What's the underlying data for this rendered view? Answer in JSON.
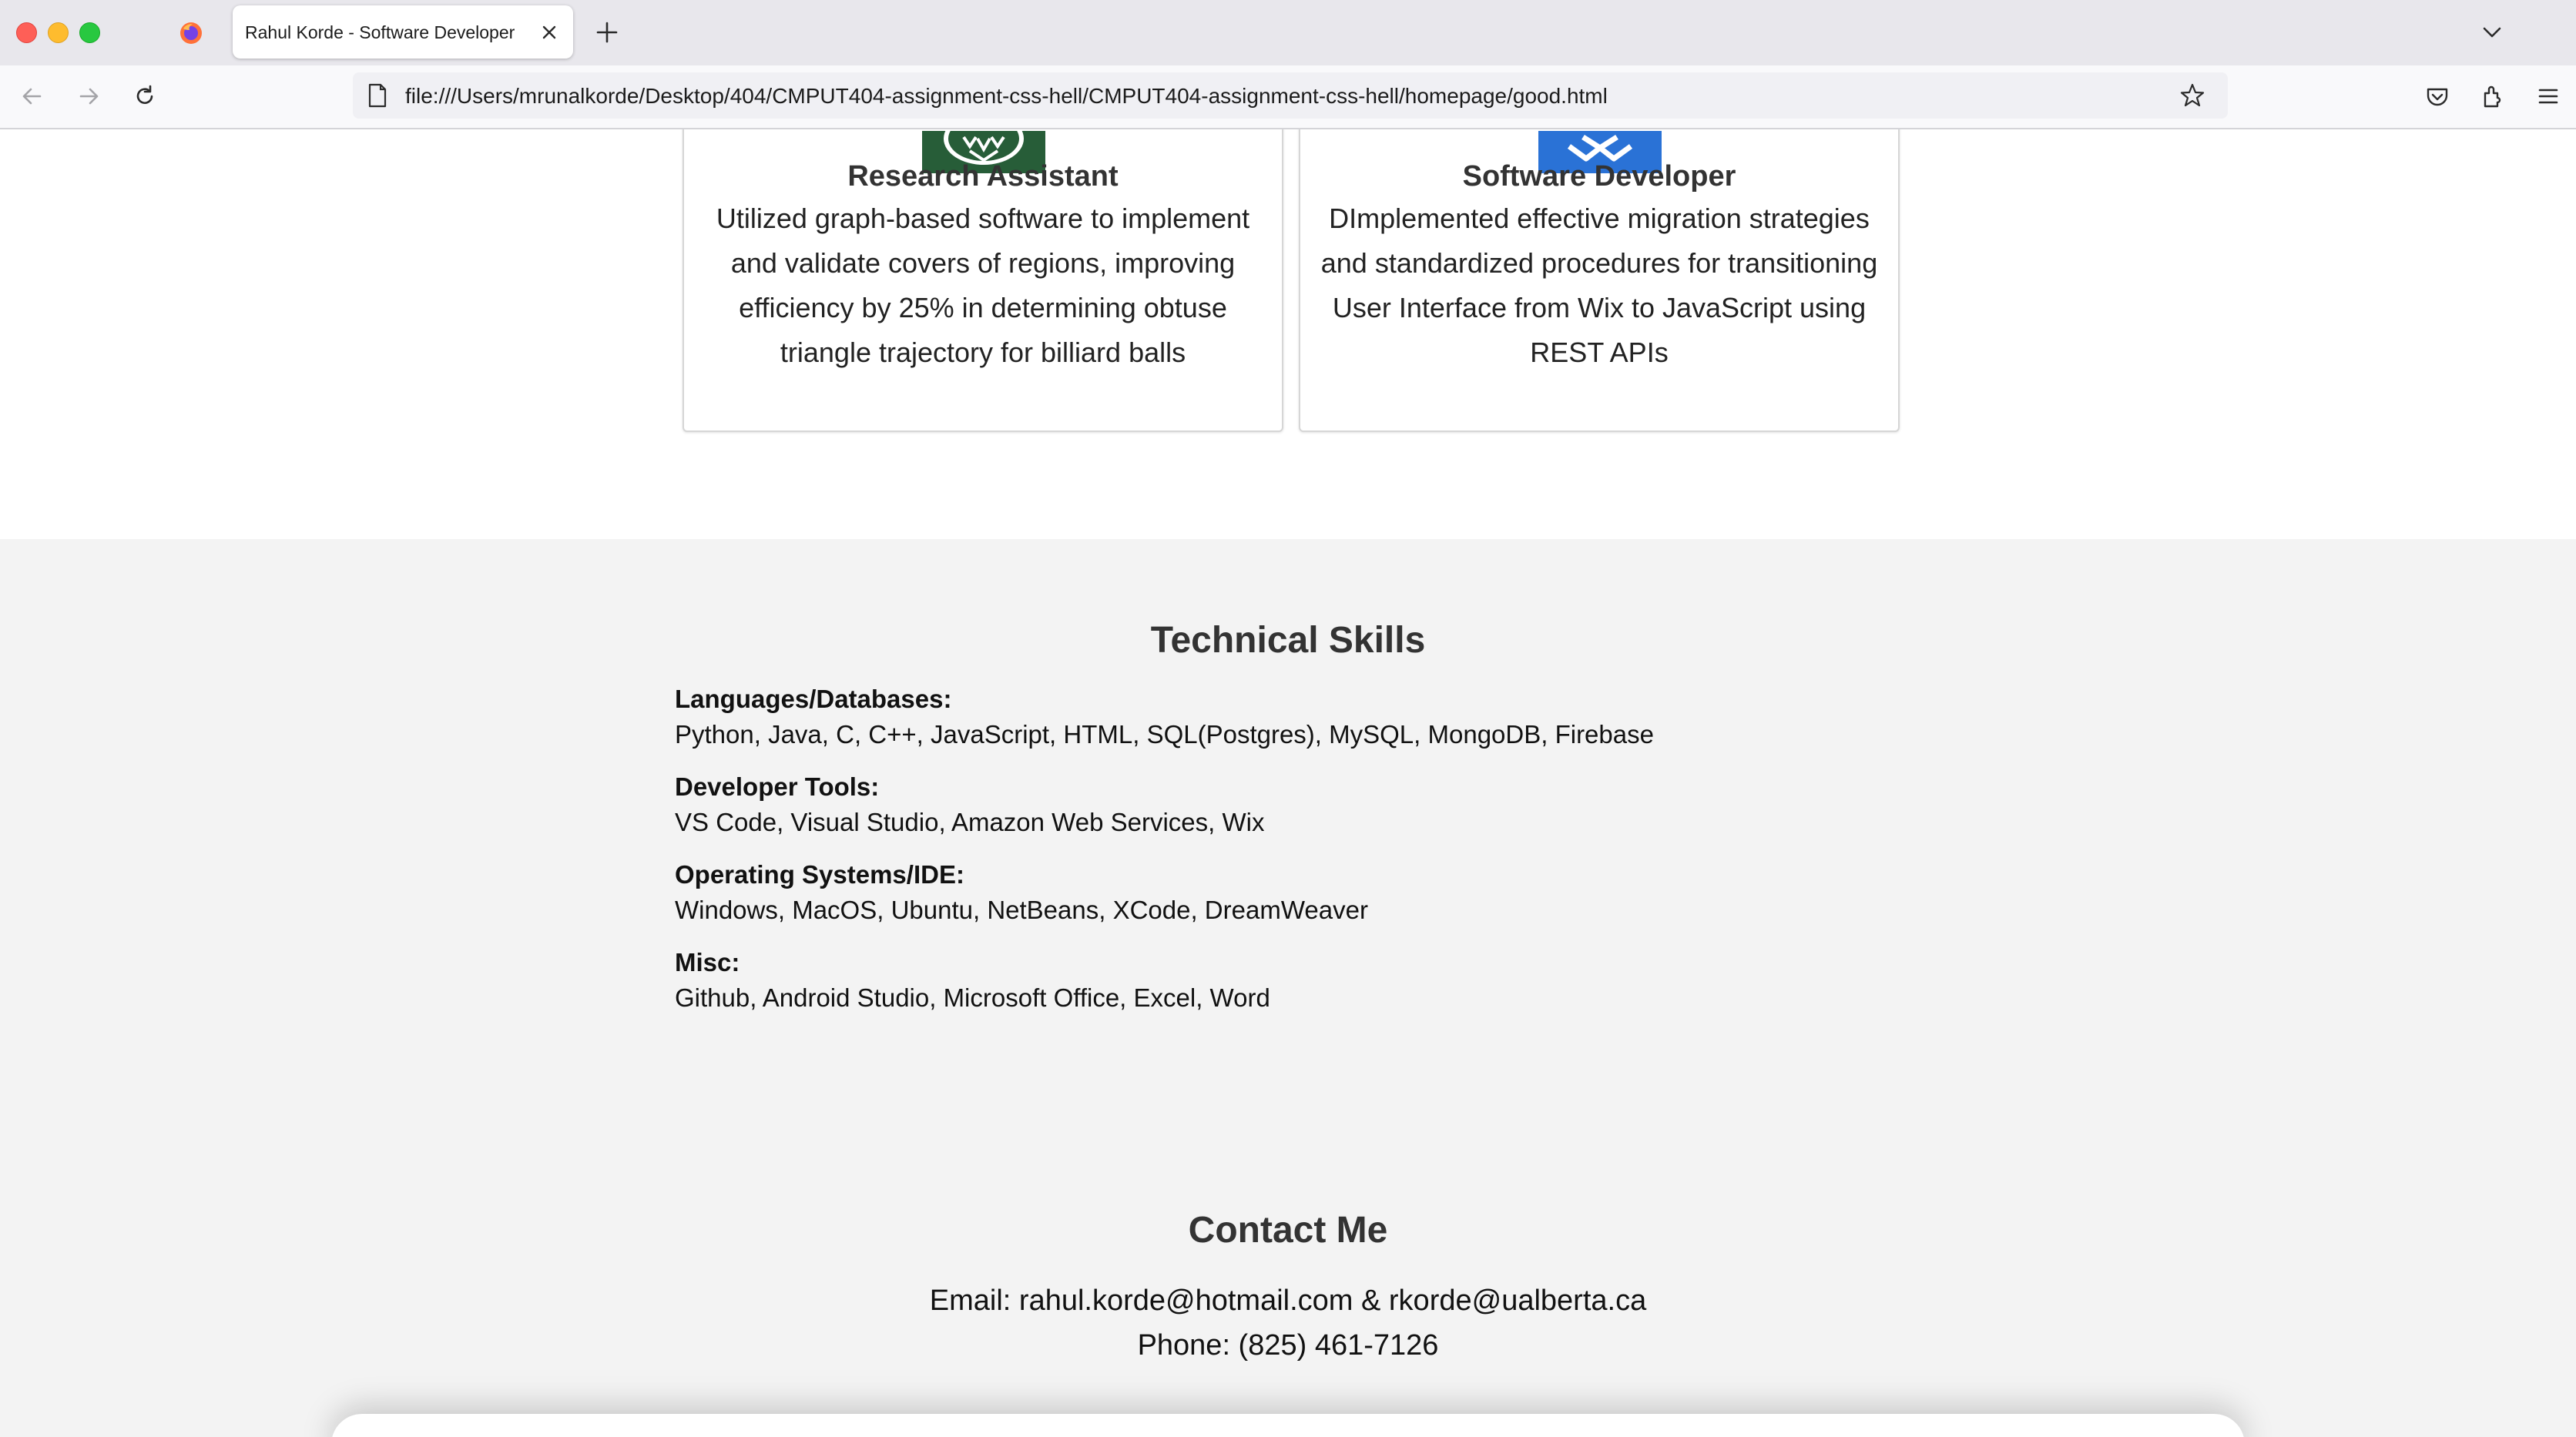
{
  "browser": {
    "tab_title": "Rahul Korde - Software Developer",
    "url": "file:///Users/mrunalkorde/Desktop/404/CMPUT404-assignment-css-hell/CMPUT404-assignment-css-hell/homepage/good.html"
  },
  "experience": [
    {
      "title": "Research Assistant",
      "description": "Utilized graph-based software to implement and validate covers of regions, improving efficiency by 25% in determining obtuse triangle trajectory for billiard balls",
      "logo_color": "#275d38"
    },
    {
      "title": "Software Developer",
      "description": "DImplemented effective migration strategies and standardized procedures for transitioning User Interface from Wix to JavaScript using REST APIs",
      "logo_color": "#2a72d6"
    }
  ],
  "skills": {
    "title": "Technical Skills",
    "items": [
      {
        "heading": "Languages/Databases:",
        "value": "Python, Java, C, C++, JavaScript, HTML, SQL(Postgres), MySQL, MongoDB, Firebase"
      },
      {
        "heading": "Developer Tools:",
        "value": "VS Code, Visual Studio, Amazon Web Services, Wix"
      },
      {
        "heading": "Operating Systems/IDE:",
        "value": "Windows, MacOS, Ubuntu, NetBeans, XCode, DreamWeaver"
      },
      {
        "heading": "Misc:",
        "value": "Github, Android Studio, Microsoft Office, Excel, Word"
      }
    ]
  },
  "contact": {
    "title": "Contact Me",
    "email_line": "Email: rahul.korde@hotmail.com & rkorde@ualberta.ca",
    "phone_line": "Phone: (825) 461-7126"
  }
}
